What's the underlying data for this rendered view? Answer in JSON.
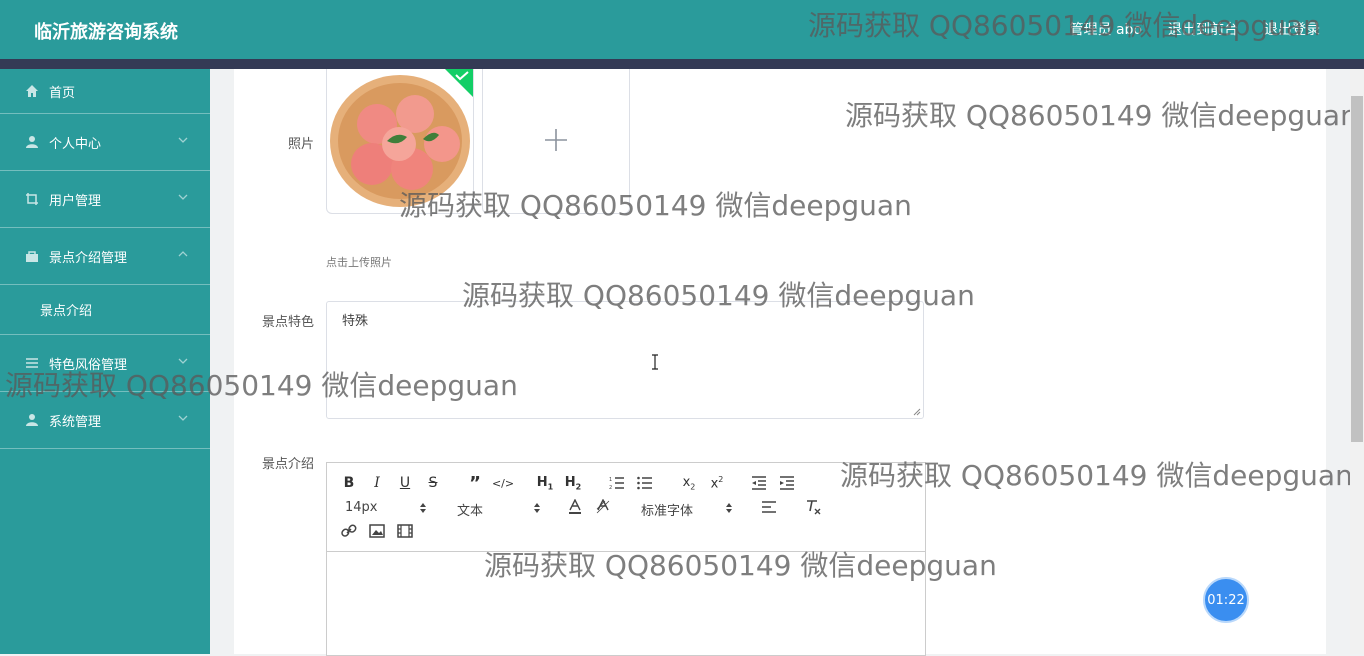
{
  "header": {
    "app_title": "临沂旅游咨询系统",
    "links": [
      "管理员 abo",
      "退出到前台",
      "退出登录"
    ]
  },
  "sidebar": {
    "items": [
      {
        "label": "首页",
        "icon": "home-icon"
      },
      {
        "label": "个人中心",
        "icon": "person-icon"
      },
      {
        "label": "用户管理",
        "icon": "crop-icon"
      },
      {
        "label": "景点介绍管理",
        "icon": "bag-icon"
      },
      {
        "label": "景点介绍",
        "icon": ""
      },
      {
        "label": "特色风俗管理",
        "icon": "list-icon"
      },
      {
        "label": "系统管理",
        "icon": "person-icon"
      }
    ]
  },
  "form": {
    "photo_label": "照片",
    "upload_tip": "点击上传照片",
    "feature_label": "景点特色",
    "feature_value": "特殊",
    "intro_label": "景点介绍"
  },
  "editor": {
    "font_size": "14px",
    "text_type": "文本",
    "font_family": "标准字体"
  },
  "watermark": "源码获取 QQ86050149 微信deepguan",
  "timer": "01:22",
  "colors": {
    "teal": "#2a9b9b",
    "stripe": "#343a55",
    "timer": "#3a8ef0"
  }
}
